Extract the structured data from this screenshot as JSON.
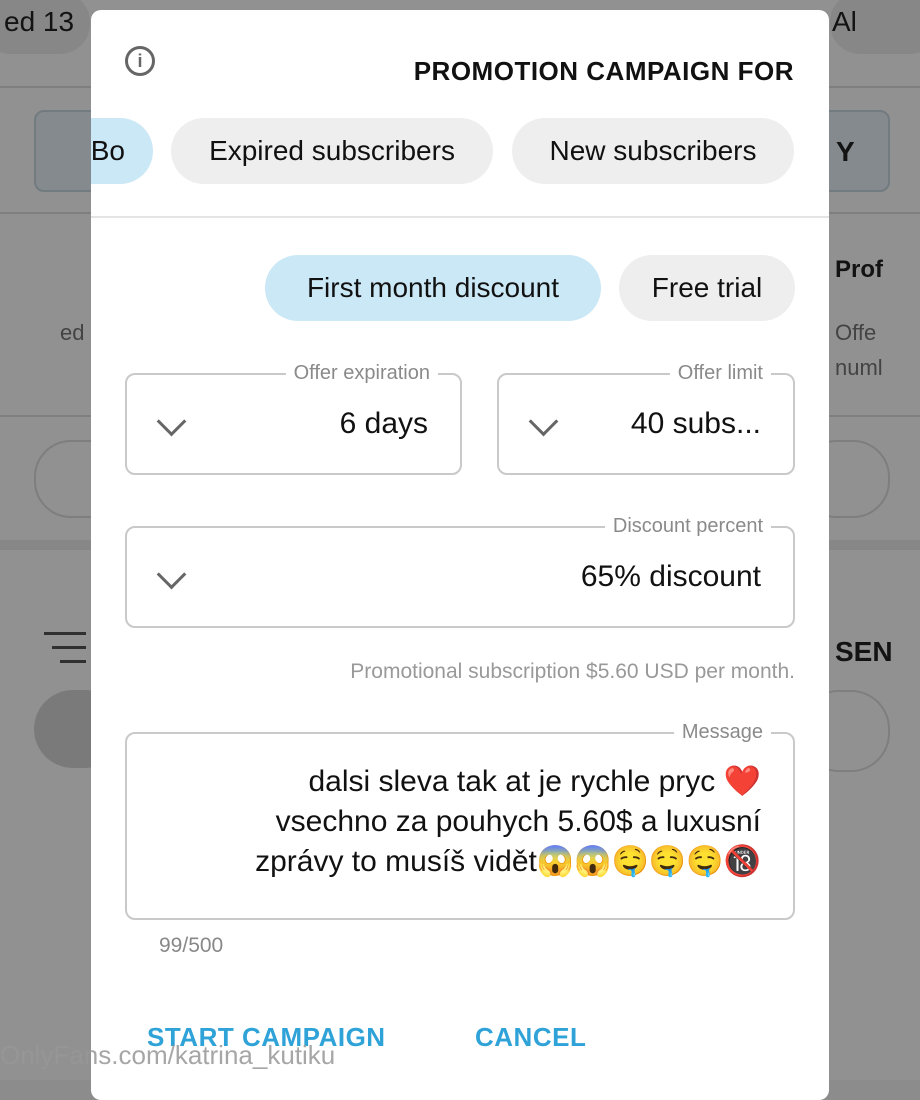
{
  "background": {
    "top_left": "ed 13",
    "top_right": "Al",
    "tab_left": "Y",
    "section_title": "Prof",
    "section_line1_right": "Offe",
    "section_line1_left": "ed",
    "section_line2": "numl",
    "bottom_title": "SEN"
  },
  "modal": {
    "title": "PROMOTION CAMPAIGN FOR",
    "info_icon": "info-icon",
    "audience_tabs": [
      {
        "label": "New subscribers",
        "active": false
      },
      {
        "label": "Expired subscribers",
        "active": false
      },
      {
        "label": "Bo",
        "active": true
      }
    ],
    "offer_types": [
      {
        "label": "Free trial",
        "active": false
      },
      {
        "label": "First month discount",
        "active": true
      }
    ],
    "offer_limit": {
      "label": "Offer limit",
      "value": "40 subs..."
    },
    "offer_expiration": {
      "label": "Offer expiration",
      "value": "6 days"
    },
    "discount_percent": {
      "label": "Discount percent",
      "value": "65% discount"
    },
    "helper_text": "Promotional subscription $5.60 USD per month.",
    "message": {
      "label": "Message",
      "lines": [
        "dalsi sleva tak at je rychle pryc ❤️",
        "vsechno za pouhych 5.60$ a luxusní",
        "zprávy to musíš vidět😱😱🤤🤤🤤🔞"
      ],
      "counter": "99/500"
    },
    "cancel_label": "CANCEL",
    "start_label": "START CAMPAIGN"
  },
  "watermark": "OnlyFans.com/katrina_kutiku",
  "colors": {
    "accent": "#2fa3d8",
    "active_chip": "#cbe8f6",
    "chip": "#eeeeee"
  }
}
